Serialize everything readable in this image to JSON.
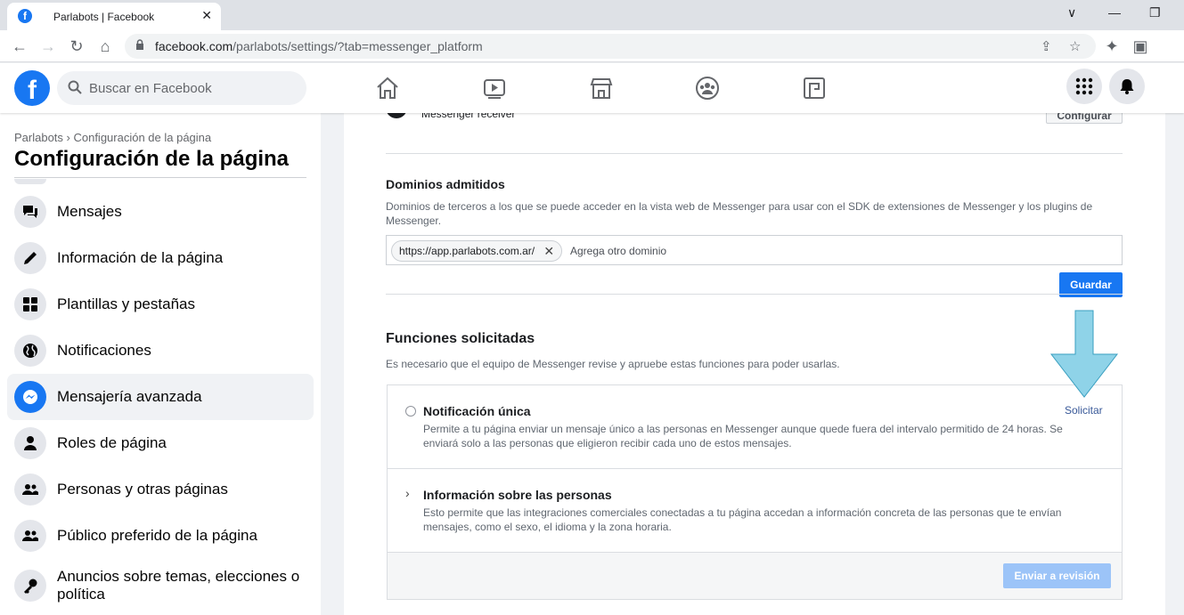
{
  "browser": {
    "tab_title": "Parlabots | Facebook",
    "tab_favicon": "f",
    "tab_close": "✕",
    "url_host": "facebook.com",
    "url_path": "/parlabots/settings/?tab=messenger_platform",
    "win_min": "∨",
    "win_minimize": "—",
    "win_restore": "❐"
  },
  "header": {
    "logo": "f",
    "search_placeholder": "Buscar en Facebook"
  },
  "sidebar": {
    "breadcrumb": "Parlabots › Configuración de la página",
    "title": "Configuración de la página",
    "items": [
      {
        "label": "Mensajes",
        "icon": "chat-bubbles-icon"
      },
      {
        "label": "Información de la página",
        "icon": "pencil-icon"
      },
      {
        "label": "Plantillas y pestañas",
        "icon": "grid-icon"
      },
      {
        "label": "Notificaciones",
        "icon": "globe-icon"
      },
      {
        "label": "Mensajería avanzada",
        "icon": "messenger-icon",
        "active": true
      },
      {
        "label": "Roles de página",
        "icon": "person-icon"
      },
      {
        "label": "Personas y otras páginas",
        "icon": "people-icon"
      },
      {
        "label": "Público preferido de la página",
        "icon": "people-icon"
      },
      {
        "label": "Anuncios sobre temas, elecciones o política",
        "icon": "key-icon"
      }
    ]
  },
  "main": {
    "messenger_row_label": "Messenger receiver",
    "configure_button": "Configurar",
    "domains": {
      "title": "Dominios admitidos",
      "description": "Dominios de terceros a los que se puede acceder en la vista web de Messenger para usar con el SDK de extensiones de Messenger y los plugins de Messenger.",
      "chip": "https://app.parlabots.com.ar/",
      "chip_remove": "✕",
      "placeholder": "Agrega otro dominio",
      "save": "Guardar"
    },
    "functions": {
      "title": "Funciones solicitadas",
      "description": "Es necesario que el equipo de Messenger revise y apruebe estas funciones para poder usarlas.",
      "items": [
        {
          "name": "Notificación única",
          "text": "Permite a tu página enviar un mensaje único a las personas en Messenger aunque quede fuera del intervalo permitido de 24 horas. Se enviará solo a las personas que eligieron recibir cada uno de estos mensajes.",
          "action": "Solicitar"
        },
        {
          "name": "Información sobre las personas",
          "text": "Esto permite que las integraciones comerciales conectadas a tu página accedan a información concreta de las personas que te envían mensajes, como el sexo, el idioma y la zona horaria."
        }
      ],
      "chevron": "›",
      "submit": "Enviar a revisión"
    }
  },
  "colors": {
    "brand": "#1877f2",
    "annotation_arrow": "#8fd3e8"
  }
}
